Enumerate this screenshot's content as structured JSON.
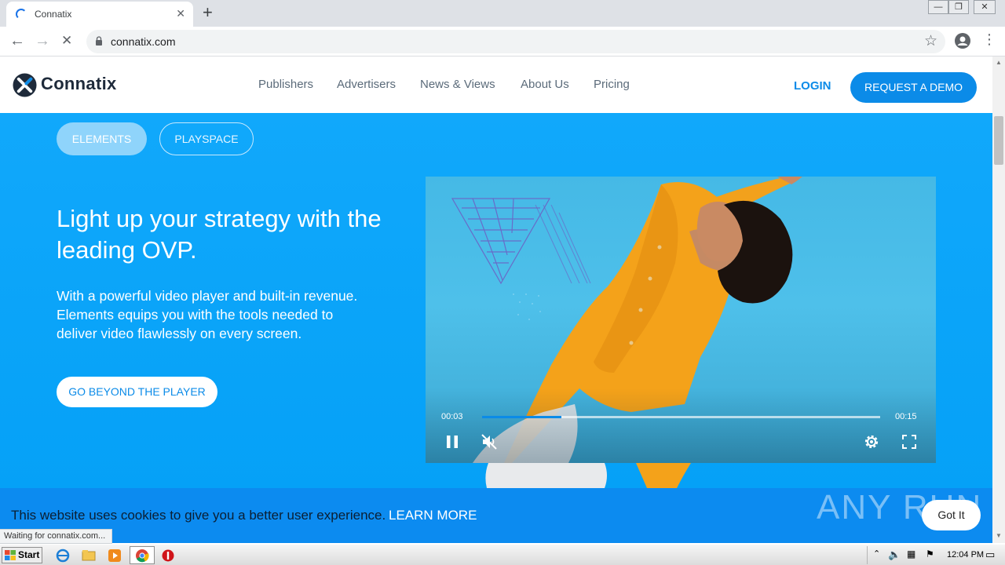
{
  "browser": {
    "tab_title": "Connatix",
    "tab_close": "✕",
    "new_tab": "+",
    "url": "connatix.com",
    "back": "←",
    "forward": "→",
    "stop": "✕",
    "bookmark": "☆",
    "menu": "⋮",
    "window_controls": [
      "—",
      "❐",
      "✕"
    ],
    "status_text": "Waiting for connatix.com..."
  },
  "header": {
    "brand": "Connatix",
    "nav": [
      "Publishers",
      "Advertisers",
      "News & Views",
      "About Us",
      "Pricing"
    ],
    "login": "LOGIN",
    "demo": "REQUEST A DEMO"
  },
  "hero": {
    "tabs": [
      "ELEMENTS",
      "PLAYSPACE"
    ],
    "active_tab": "ELEMENTS",
    "headline": "Light up your strategy with the leading OVP.",
    "body": "With a powerful video player and built-in revenue. Elements equips you with the tools needed to deliver video flawlessly on every screen.",
    "cta": "GO BEYOND THE PLAYER"
  },
  "player": {
    "current_time": "00:03",
    "duration": "00:15",
    "progress": 0.2,
    "state": "playing",
    "muted": true
  },
  "cookie": {
    "text": "This website uses cookies to give you a better user experience.",
    "learn_more": "LEARN MORE",
    "accept": "Got It"
  },
  "watermark": "ANY RUN",
  "taskbar": {
    "start": "Start",
    "clock": "12:04 PM"
  },
  "colors": {
    "brand_blue": "#0b8be8",
    "hero_blue": "#11a8fb",
    "cookie_blue": "#0c8bf0"
  }
}
